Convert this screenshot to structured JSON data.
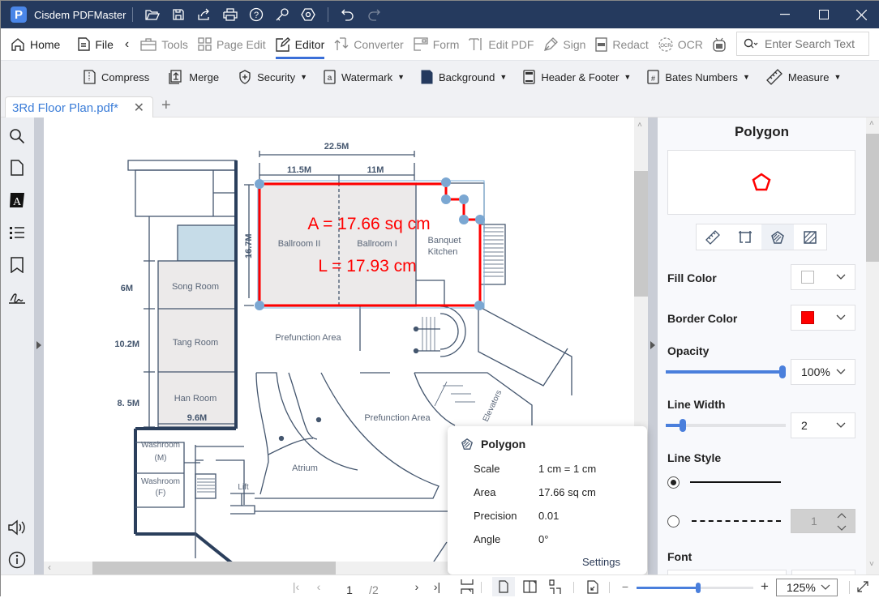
{
  "app": {
    "title": "Cisdem PDFMaster",
    "logo_letter": "P"
  },
  "titlebar_icons": [
    "open-folder-icon",
    "save-icon",
    "share-icon",
    "print-icon",
    "help-icon",
    "key-icon",
    "settings-icon",
    "undo-icon",
    "redo-icon"
  ],
  "menu": {
    "items": [
      {
        "label": "Home",
        "icon": "home-icon"
      },
      {
        "label": "File",
        "icon": "file-icon"
      },
      {
        "label": "Tools",
        "icon": "toolbox-icon"
      },
      {
        "label": "Page Edit",
        "icon": "grid-icon"
      },
      {
        "label": "Editor",
        "icon": "edit-icon",
        "active": true
      },
      {
        "label": "Converter",
        "icon": "convert-icon"
      },
      {
        "label": "Form",
        "icon": "form-icon"
      },
      {
        "label": "Edit PDF",
        "icon": "text-cursor-icon"
      },
      {
        "label": "Sign",
        "icon": "pen-icon"
      },
      {
        "label": "Redact",
        "icon": "redact-icon"
      },
      {
        "label": "OCR",
        "icon": "ocr-icon"
      }
    ],
    "search_placeholder": "Enter Search Text"
  },
  "subtoolbar": {
    "items": [
      {
        "label": "Compress",
        "icon": "compress-icon",
        "dropdown": false
      },
      {
        "label": "Merge",
        "icon": "merge-icon",
        "dropdown": false
      },
      {
        "label": "Security",
        "icon": "shield-icon",
        "dropdown": true
      },
      {
        "label": "Watermark",
        "icon": "watermark-icon",
        "dropdown": true
      },
      {
        "label": "Background",
        "icon": "background-icon",
        "dropdown": true
      },
      {
        "label": "Header & Footer",
        "icon": "header-footer-icon",
        "dropdown": true
      },
      {
        "label": "Bates Numbers",
        "icon": "bates-icon",
        "dropdown": true
      },
      {
        "label": "Measure",
        "icon": "ruler-icon",
        "dropdown": true
      }
    ]
  },
  "tabs": [
    {
      "label": "3Rd Floor Plan.pdf*",
      "active": true
    }
  ],
  "floorplan": {
    "dims": {
      "total_width": "22.5M",
      "left_width": "11.5M",
      "right_width": "11M",
      "height": "16.7M",
      "song": "6M",
      "tang": "10.2M",
      "han": "8. 5M",
      "room_width": "9.6M"
    },
    "rooms": {
      "ballroom2": "Ballroom II",
      "ballroom1": "Ballroom I",
      "banquet1": "Banquet",
      "banquet2": "Kitchen",
      "song": "Song Room",
      "tang": "Tang Room",
      "han": "Han Room",
      "prefunction": "Prefunction Area",
      "prefunction2": "Prefunction Area",
      "atrium": "Atrium",
      "lift": "Lift",
      "washroom_m1": "Washroom",
      "washroom_m2": "(M)",
      "washroom_f1": "Washroom",
      "washroom_f2": "(F)",
      "elevators": "Elevators"
    },
    "measure_area": "A = 17.66 sq cm",
    "measure_length": "L = 17.93 cm",
    "measure_color": "#ff0000"
  },
  "panel": {
    "title": "Polygon",
    "fill_color_label": "Fill Color",
    "fill_color": "#ffffff",
    "border_color_label": "Border Color",
    "border_color": "#ff0000",
    "opacity_label": "Opacity",
    "opacity_value": "100%",
    "opacity_fraction": 1.0,
    "line_width_label": "Line Width",
    "line_width_value": "2",
    "line_width_fraction": 0.12,
    "line_style_label": "Line Style",
    "line_style_selected": "solid",
    "dash_value": "1",
    "font_label": "Font"
  },
  "popup": {
    "title": "Polygon",
    "rows": [
      {
        "key": "Scale",
        "value": "1 cm = 1 cm"
      },
      {
        "key": "Area",
        "value": "17.66 sq cm"
      },
      {
        "key": "Precision",
        "value": "0.01"
      },
      {
        "key": "Angle",
        "value": "0°"
      }
    ],
    "settings_label": "Settings"
  },
  "bottom": {
    "page_current": "1",
    "page_total": "/2",
    "zoom_value": "125%",
    "zoom_fraction": 0.53
  }
}
